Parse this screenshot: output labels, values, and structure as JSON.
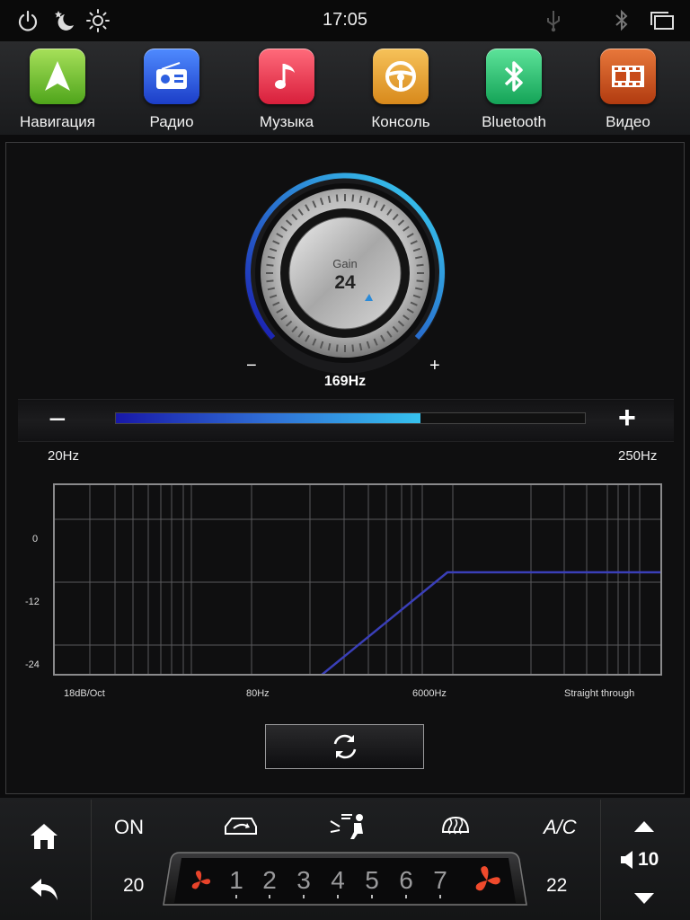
{
  "status": {
    "time": "17:05"
  },
  "apps": [
    {
      "label": "Навигация",
      "icon": "navigation-arrow-icon",
      "color": "#6fc22b"
    },
    {
      "label": "Радио",
      "icon": "radio-icon",
      "color": "#2d5fe0"
    },
    {
      "label": "Музыка",
      "icon": "music-note-icon",
      "color": "#e8384f"
    },
    {
      "label": "Консоль",
      "icon": "steering-wheel-icon",
      "color": "#e8a23a"
    },
    {
      "label": "Bluetooth",
      "icon": "bluetooth-icon",
      "color": "#27c070"
    },
    {
      "label": "Видео",
      "icon": "film-icon",
      "color": "#d3531a"
    }
  ],
  "knob": {
    "label": "Gain",
    "value": "24",
    "minus": "−",
    "plus": "+",
    "frequency": "169Hz"
  },
  "slider": {
    "minus": "−",
    "plus": "+",
    "min_label": "20Hz",
    "max_label": "250Hz",
    "level": 0.65
  },
  "chart_data": {
    "type": "line",
    "yticks": [
      "0",
      "-12",
      "-24"
    ],
    "xlabels": [
      "18dB/Oct",
      "80Hz",
      "6000Hz",
      "Straight through"
    ]
  },
  "climate": {
    "on_label": "ON",
    "ac_label": "A/C",
    "temp_left": "20",
    "temp_right": "22",
    "fan_levels": [
      "1",
      "2",
      "3",
      "4",
      "5",
      "6",
      "7"
    ],
    "volume": "10"
  }
}
